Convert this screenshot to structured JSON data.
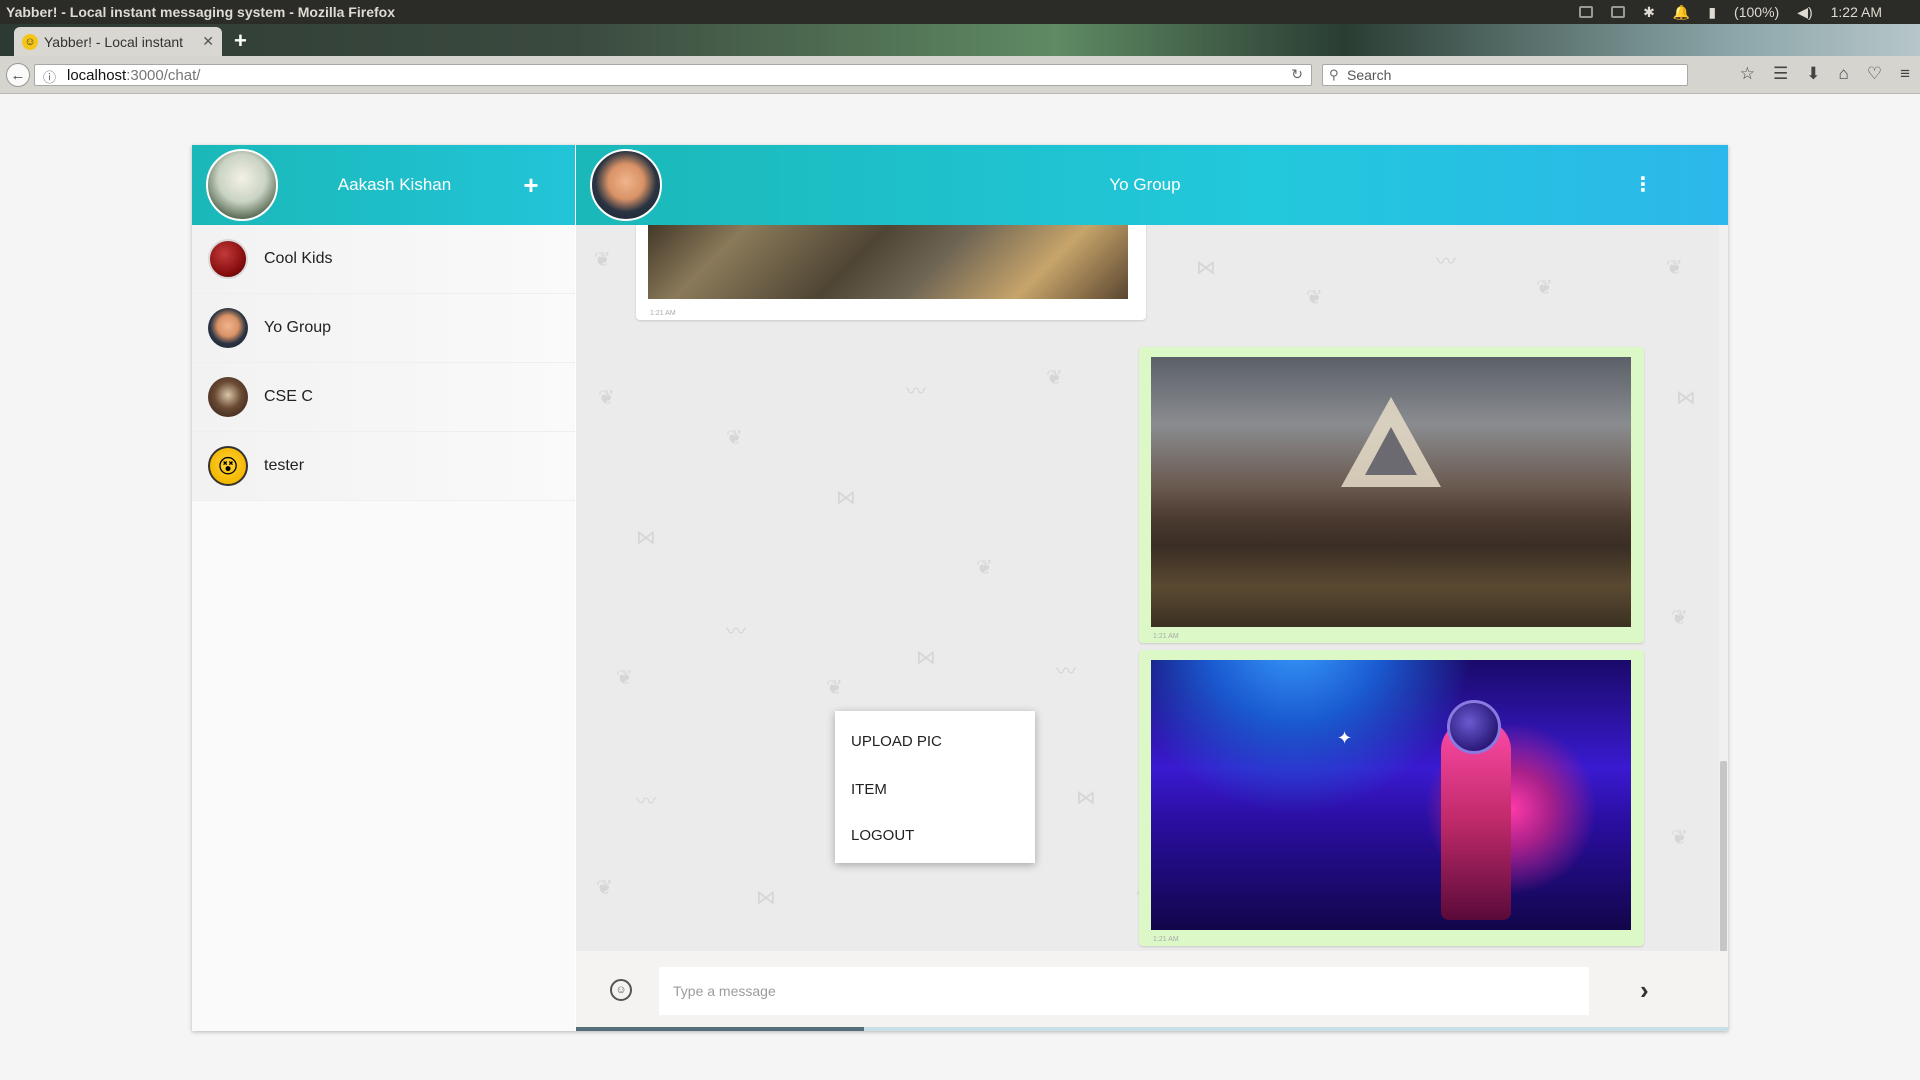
{
  "os": {
    "window_title": "Yabber! - Local instant messaging system - Mozilla Firefox",
    "battery": "(100%)",
    "clock": "1:22 AM"
  },
  "browser": {
    "tab_title": "Yabber! - Local instant",
    "url_host": "localhost",
    "url_path": ":3000/chat/",
    "search_placeholder": "Search"
  },
  "sidebar": {
    "user_name": "Aakash Kishan",
    "add_icon": "plus-icon",
    "contacts": [
      {
        "name": "Cool Kids"
      },
      {
        "name": "Yo Group"
      },
      {
        "name": "CSE C"
      },
      {
        "name": "tester"
      }
    ]
  },
  "chat": {
    "title": "Yo Group",
    "menu_icon": "kebab-menu-icon",
    "messages": [
      {
        "time": "1:21 AM"
      },
      {
        "time": "1:21 AM"
      },
      {
        "time": "1:21 AM"
      }
    ],
    "menu_items": [
      {
        "label": "UPLOAD PIC"
      },
      {
        "label": "ITEM"
      },
      {
        "label": "LOGOUT"
      }
    ]
  },
  "compose": {
    "placeholder": "Type a message",
    "progress": 0.25
  },
  "colors": {
    "header_accent": "#1ab8b8",
    "own_bubble": "#dcf8c6",
    "chat_bg": "#ebebeb"
  }
}
